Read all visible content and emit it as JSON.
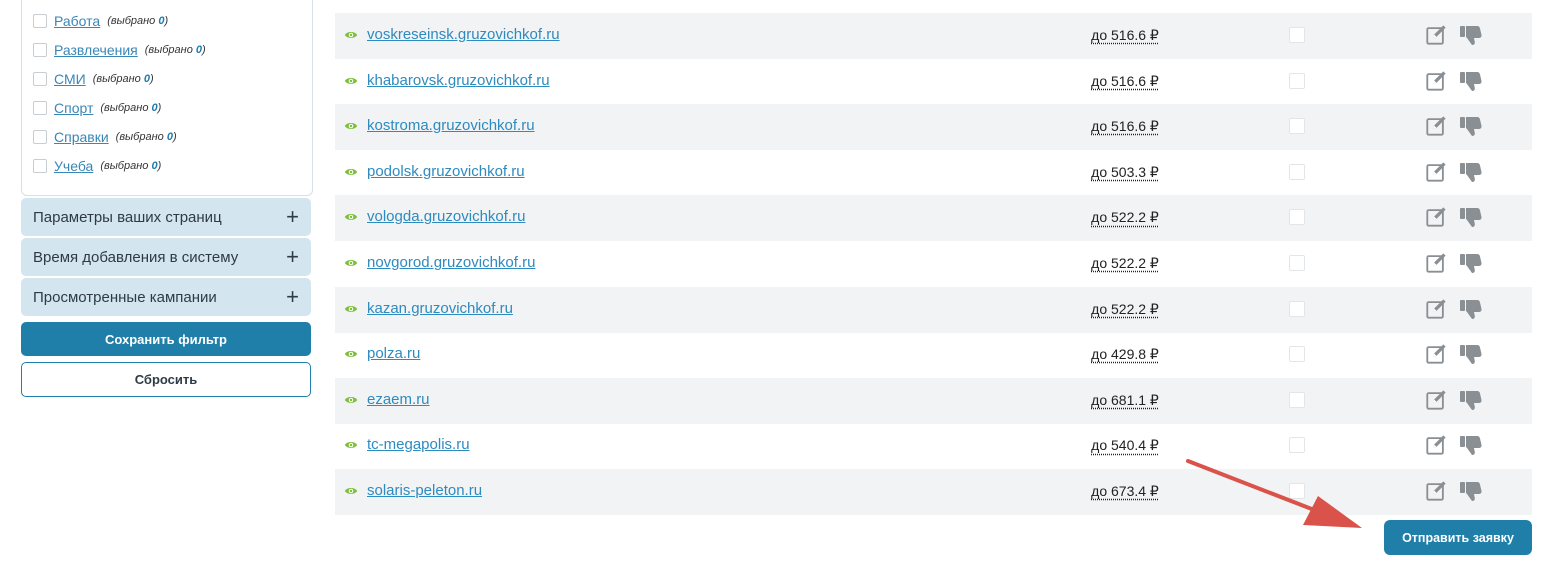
{
  "categories": [
    {
      "label": "Работа",
      "note_prefix": "(выбрано ",
      "count": "0",
      "note_suffix": ")"
    },
    {
      "label": "Развлечения",
      "note_prefix": "(выбрано ",
      "count": "0",
      "note_suffix": ")"
    },
    {
      "label": "СМИ",
      "note_prefix": "(выбрано ",
      "count": "0",
      "note_suffix": ")"
    },
    {
      "label": "Спорт",
      "note_prefix": "(выбрано ",
      "count": "0",
      "note_suffix": ")"
    },
    {
      "label": "Справки",
      "note_prefix": "(выбрано ",
      "count": "0",
      "note_suffix": ")"
    },
    {
      "label": "Учеба",
      "note_prefix": "(выбрано ",
      "count": "0",
      "note_suffix": ")"
    }
  ],
  "accordions": [
    {
      "label": "Параметры ваших страниц",
      "icon": "plus"
    },
    {
      "label": "Время добавления в систему",
      "icon": "plus"
    },
    {
      "label": "Просмотренные кампании",
      "icon": "plus"
    }
  ],
  "buttons": {
    "save_filter": "Сохранить фильтр",
    "reset": "Сбросить",
    "submit": "Отправить заявку"
  },
  "rows": [
    {
      "site": "voskreseinsk.gruzovichkof.ru",
      "price": "до 516.6 ₽"
    },
    {
      "site": "khabarovsk.gruzovichkof.ru",
      "price": "до 516.6 ₽"
    },
    {
      "site": "kostroma.gruzovichkof.ru",
      "price": "до 516.6 ₽"
    },
    {
      "site": "podolsk.gruzovichkof.ru",
      "price": "до 503.3 ₽"
    },
    {
      "site": "vologda.gruzovichkof.ru",
      "price": "до 522.2 ₽"
    },
    {
      "site": "novgorod.gruzovichkof.ru",
      "price": "до 522.2 ₽"
    },
    {
      "site": "kazan.gruzovichkof.ru",
      "price": "до 522.2 ₽"
    },
    {
      "site": "polza.ru",
      "price": "до 429.8 ₽"
    },
    {
      "site": "ezaem.ru",
      "price": "до 681.1 ₽"
    },
    {
      "site": "tc-megapolis.ru",
      "price": "до 540.4 ₽"
    },
    {
      "site": "solaris-peleton.ru",
      "price": "до 673.4 ₽"
    }
  ],
  "colors": {
    "accent": "#1f7fa9",
    "link": "#2d8bc0",
    "eye_icon": "#7cbf3a",
    "row_shade": "#f2f3f4",
    "annotation_arrow": "#d9534a"
  }
}
